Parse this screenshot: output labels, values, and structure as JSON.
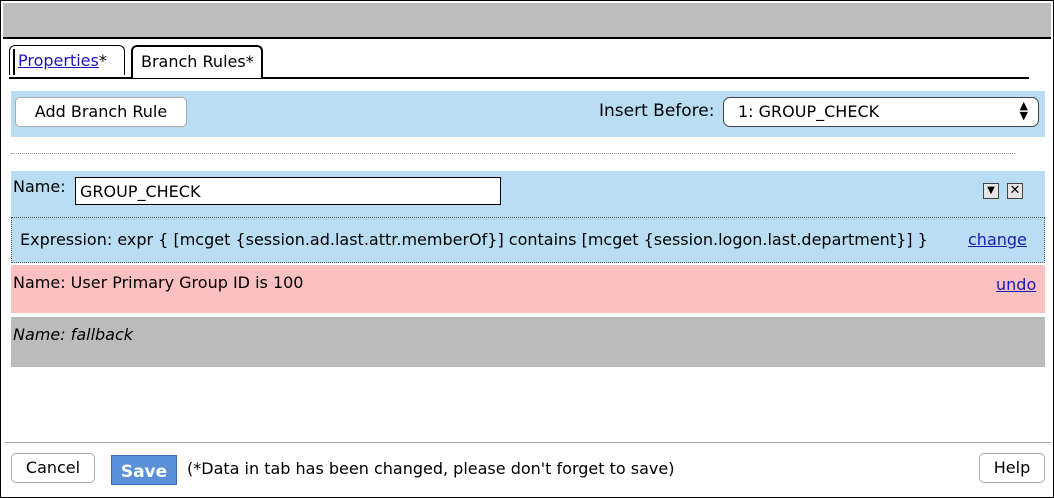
{
  "tabs": [
    {
      "label": "Properties",
      "suffix": "*"
    },
    {
      "label": "Branch Rules*"
    }
  ],
  "toolbar": {
    "add_label": "Add Branch Rule",
    "insert_label": "Insert Before:",
    "insert_value": "1: GROUP_CHECK"
  },
  "rules": [
    {
      "name_label": "Name:",
      "name_value": "GROUP_CHECK",
      "expression": "Expression: expr { [mcget {session.ad.last.attr.memberOf}] contains [mcget {session.logon.last.department}] }",
      "action_link": "change"
    },
    {
      "label": "Name: User Primary Group ID is 100",
      "action_link": "undo"
    },
    {
      "label": "Name: fallback"
    }
  ],
  "footer": {
    "cancel_label": "Cancel",
    "save_label": "Save",
    "message": "(*Data in tab has been changed, please don't forget to save)",
    "help_label": "Help"
  },
  "colors": {
    "blue_panel": "#b9ddf3",
    "pink_panel": "#fbc0c0",
    "gray_panel": "#bbbbbb",
    "save_button": "#5a90d8",
    "link": "#1a1ab0"
  },
  "icons": [
    "dropdown-arrow-icon",
    "close-icon",
    "select-arrows-icon"
  ]
}
